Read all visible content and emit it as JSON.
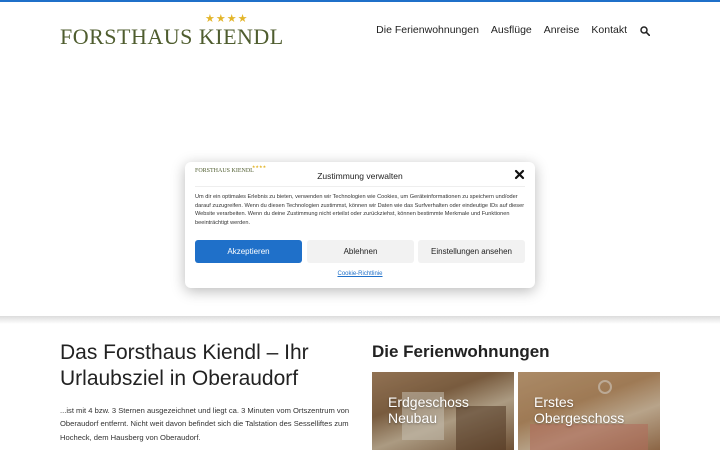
{
  "header": {
    "logo_text": "FORSTHAUS KIENDL",
    "logo_stars": "★★★★",
    "nav": [
      "Die Ferienwohnungen",
      "Ausflüge",
      "Anreise",
      "Kontakt"
    ]
  },
  "consent": {
    "logo_text": "FORSTHAUS KIENDL",
    "title": "Zustimmung verwalten",
    "body": "Um dir ein optimales Erlebnis zu bieten, verwenden wir Technologien wie Cookies, um Geräteinformationen zu speichern und/oder darauf zuzugreifen. Wenn du diesen Technologien zustimmst, können wir Daten wie das Surfverhalten oder eindeutige IDs auf dieser Website verarbeiten. Wenn du deine Zustimmung nicht erteilst oder zurückziehst, können bestimmte Merkmale und Funktionen beeinträchtigt werden.",
    "accept_label": "Akzeptieren",
    "deny_label": "Ablehnen",
    "settings_label": "Einstellungen ansehen",
    "policy_link": "Cookie-Richtlinie"
  },
  "intro": {
    "title": "Das Forsthaus Kiendl – Ihr Urlaubsziel in Oberaudorf",
    "text": "...ist mit 4 bzw. 3 Sternen ausgezeichnet und liegt ca. 3 Minuten vom Ortszentrum von Oberaudorf entfernt. Nicht weit davon befindet sich die Talstation des Sesselliftes zum Hocheck, dem Hausberg von Oberaudorf."
  },
  "apartments": {
    "title": "Die Ferienwohnungen",
    "cards": [
      {
        "label": "Erdgeschoss\nNeubau"
      },
      {
        "label": "Erstes\nObergeschoss"
      }
    ]
  },
  "colors": {
    "accent": "#1f70c9",
    "logo_green": "#4f5d2f",
    "star_gold": "#e3b52a"
  },
  "icons": {
    "search": "search-icon",
    "close": "close-icon"
  }
}
